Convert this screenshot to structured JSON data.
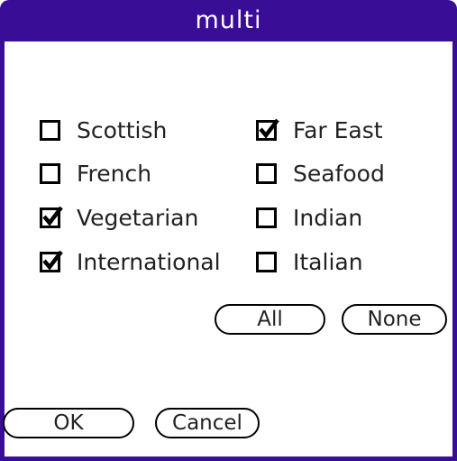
{
  "dialog": {
    "title": "multi"
  },
  "checkboxes": {
    "left": [
      {
        "label": "Scottish",
        "checked": false
      },
      {
        "label": "French",
        "checked": false
      },
      {
        "label": "Vegetarian",
        "checked": true
      },
      {
        "label": "International",
        "checked": true
      }
    ],
    "right": [
      {
        "label": "Far East",
        "checked": true
      },
      {
        "label": "Seafood",
        "checked": false
      },
      {
        "label": "Indian",
        "checked": false
      },
      {
        "label": "Italian",
        "checked": false
      }
    ]
  },
  "buttons": {
    "all": "All",
    "none": "None",
    "ok": "OK",
    "cancel": "Cancel"
  },
  "icons": {
    "check": "checkmark-icon"
  },
  "colors": {
    "title_bar": "#3a0d96",
    "title_text": "#ffffff"
  }
}
